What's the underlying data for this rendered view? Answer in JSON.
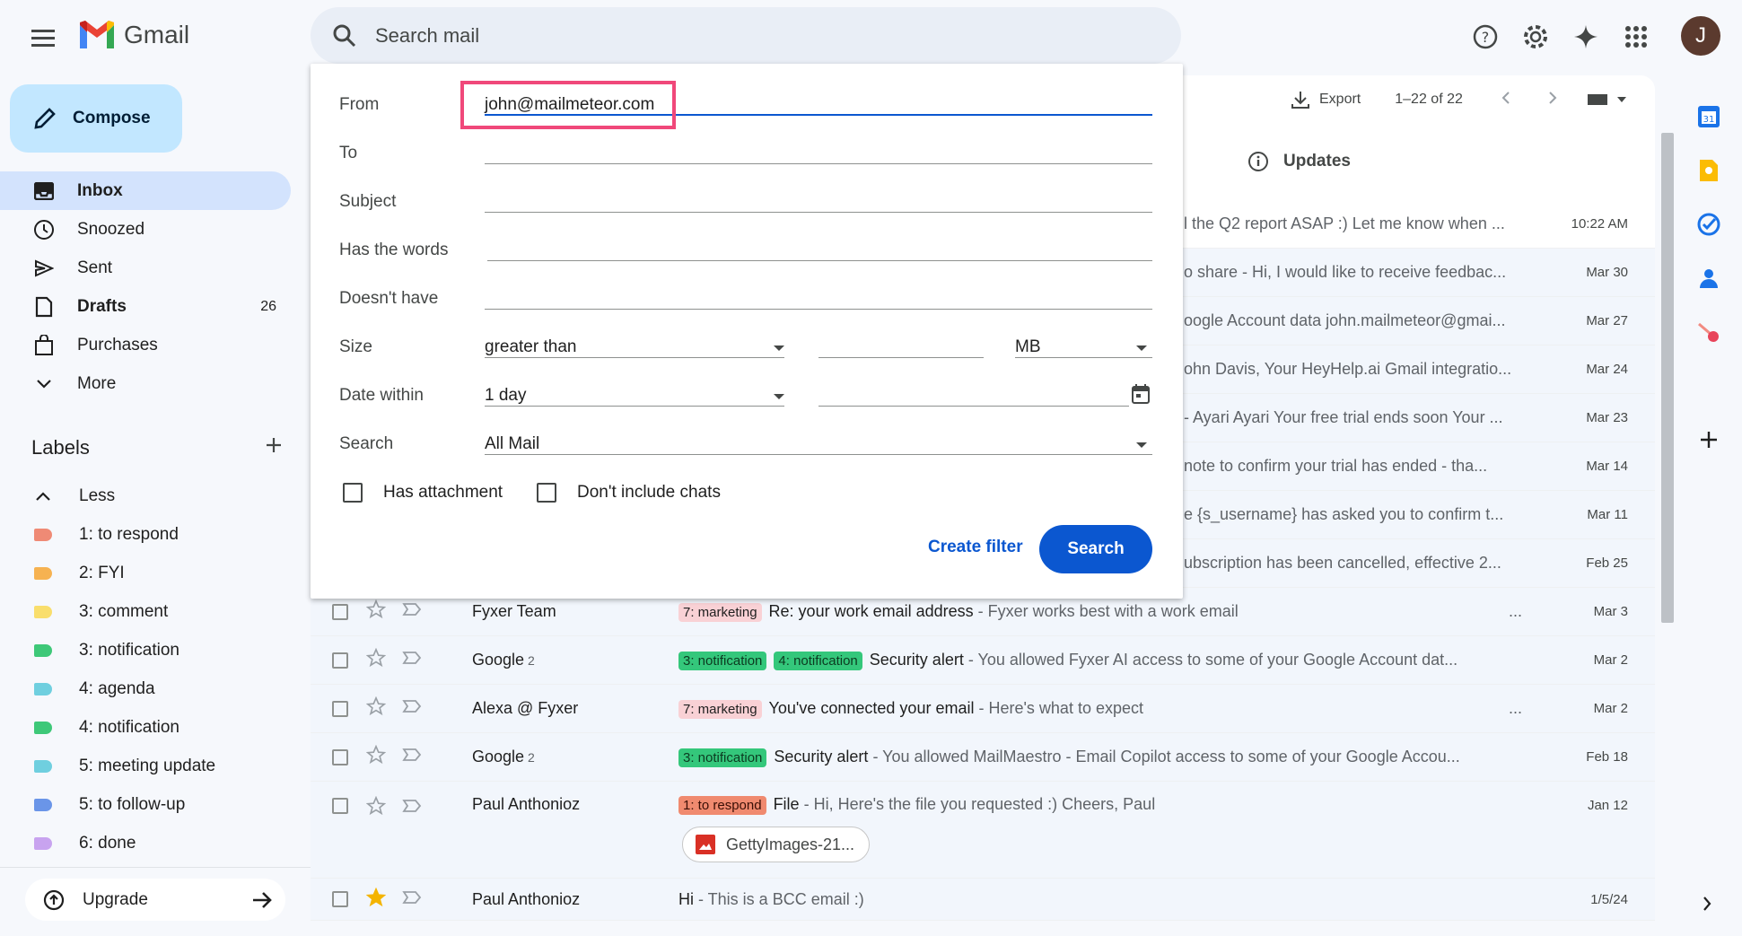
{
  "header": {
    "app_name": "Gmail",
    "search_placeholder": "Search mail",
    "avatar_initial": "J"
  },
  "sidebar": {
    "compose_label": "Compose",
    "nav": [
      {
        "label": "Inbox",
        "icon": "inbox-icon",
        "count": ""
      },
      {
        "label": "Snoozed",
        "icon": "clock-icon",
        "count": ""
      },
      {
        "label": "Sent",
        "icon": "send-icon",
        "count": ""
      },
      {
        "label": "Drafts",
        "icon": "draft-icon",
        "count": "26"
      },
      {
        "label": "Purchases",
        "icon": "shopping-bag-icon",
        "count": ""
      },
      {
        "label": "More",
        "icon": "chevron-down-icon",
        "count": ""
      }
    ],
    "labels_title": "Labels",
    "labels": [
      {
        "label": "Less",
        "color": ""
      },
      {
        "label": "1: to respond",
        "color": "#ef8a75"
      },
      {
        "label": "2: FYI",
        "color": "#f6b251"
      },
      {
        "label": "3: comment",
        "color": "#f9de6c"
      },
      {
        "label": "3: notification",
        "color": "#3ec878"
      },
      {
        "label": "4: agenda",
        "color": "#6fcfdf"
      },
      {
        "label": "4: notification",
        "color": "#3ec878"
      },
      {
        "label": "5: meeting update",
        "color": "#6fcfdf"
      },
      {
        "label": "5: to follow-up",
        "color": "#6a95e8"
      },
      {
        "label": "6: done",
        "color": "#c8a3ef"
      }
    ],
    "upgrade_label": "Upgrade"
  },
  "toolbar": {
    "export_label": "Export",
    "pagination": "1–22 of 22",
    "updates_tab": "Updates"
  },
  "search_options": {
    "from_label": "From",
    "from_value": "john@mailmeteor.com",
    "to_label": "To",
    "subject_label": "Subject",
    "has_words_label": "Has the words",
    "doesnt_have_label": "Doesn't have",
    "size_label": "Size",
    "size_operator": "greater than",
    "size_unit": "MB",
    "date_within_label": "Date within",
    "date_within_value": "1 day",
    "search_label": "Search",
    "search_scope": "All Mail",
    "has_attachment_label": "Has attachment",
    "no_chats_label": "Don't include chats",
    "create_filter_label": "Create filter",
    "search_button_label": "Search"
  },
  "partial_rows": [
    {
      "text": "l the Q2 report ASAP :) Let me know when ...",
      "date": "10:22 AM"
    },
    {
      "text": "o share - Hi, I would like to receive feedbac...",
      "date": "Mar 30"
    },
    {
      "text": "oogle Account data john.mailmeteor@gmai...",
      "date": "Mar 27"
    },
    {
      "text": "ohn Davis, Your HeyHelp.ai Gmail integratio...",
      "date": "Mar 24"
    },
    {
      "text": "- Ayari Ayari Your free trial ends soon Your ...",
      "date": "Mar 23"
    },
    {
      "text": "note to confirm your trial has ended - tha...",
      "date": "Mar 14"
    },
    {
      "text": "e {s_username} has asked you to confirm t...",
      "date": "Mar 11"
    },
    {
      "text": "ubscription has been cancelled, effective 2...",
      "date": "Feb 25"
    }
  ],
  "rows": [
    {
      "sender": "Fyxer Team",
      "count": "",
      "chips": [
        {
          "text": "7: marketing",
          "kind": "marketing"
        }
      ],
      "subject": "Re: your work email address",
      "snippet": " - Fyxer works best with a work email",
      "trail": "...",
      "date": "Mar 3",
      "starred": false
    },
    {
      "sender": "Google",
      "count": "2",
      "chips": [
        {
          "text": "3: notification",
          "kind": "notif"
        },
        {
          "text": "4: notification",
          "kind": "notif"
        }
      ],
      "subject": "Security alert",
      "snippet": " - You allowed Fyxer AI access to some of your Google Account dat...",
      "trail": "",
      "date": "Mar 2",
      "starred": false
    },
    {
      "sender": "Alexa @ Fyxer",
      "count": "",
      "chips": [
        {
          "text": "7: marketing",
          "kind": "marketing"
        }
      ],
      "subject": "You've connected your email",
      "snippet": " - Here's what to expect",
      "trail": "...",
      "date": "Mar 2",
      "starred": false
    },
    {
      "sender": "Google",
      "count": "2",
      "chips": [
        {
          "text": "3: notification",
          "kind": "notif"
        }
      ],
      "subject": "Security alert",
      "snippet": " - You allowed MailMaestro - Email Copilot access to some of your Google Accou...",
      "trail": "",
      "date": "Feb 18",
      "starred": false
    },
    {
      "sender": "Paul Anthonioz",
      "count": "",
      "chips": [
        {
          "text": "1: to respond",
          "kind": "respond"
        }
      ],
      "subject": "File",
      "snippet": " - Hi, Here's the file you requested :) Cheers, Paul",
      "trail": "",
      "date": "Jan 12",
      "starred": false
    },
    {
      "sender": "Paul Anthonioz",
      "count": "",
      "chips": [],
      "subject": "Hi",
      "snippet": " - This is a BCC email :)",
      "trail": "",
      "date": "1/5/24",
      "starred": true
    }
  ],
  "attachment": {
    "name": "GettyImages-21..."
  }
}
